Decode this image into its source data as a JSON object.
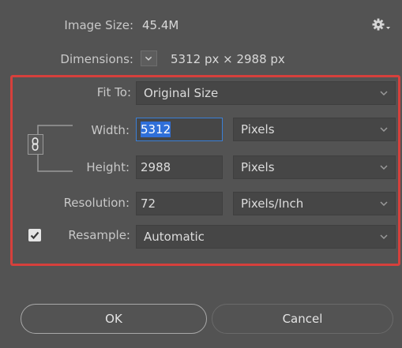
{
  "info": {
    "image_size_label": "Image Size:",
    "image_size_value": "45.4M",
    "dimensions_label": "Dimensions:",
    "dimensions_value": "5312 px  ×  2988 px"
  },
  "fit_to": {
    "label": "Fit To:",
    "value": "Original Size"
  },
  "width": {
    "label": "Width:",
    "value": "5312",
    "unit": "Pixels"
  },
  "height": {
    "label": "Height:",
    "value": "2988",
    "unit": "Pixels"
  },
  "resolution": {
    "label": "Resolution:",
    "value": "72",
    "unit": "Pixels/Inch"
  },
  "resample": {
    "label": "Resample:",
    "checked": true,
    "value": "Automatic"
  },
  "buttons": {
    "ok": "OK",
    "cancel": "Cancel"
  },
  "colors": {
    "background": "#535353",
    "field": "#464646",
    "highlight": "#d6403c",
    "selection": "#2f6fd9"
  },
  "icons": [
    "gear-icon",
    "chevron-down-icon",
    "link-chain-icon",
    "checkmark-icon"
  ]
}
